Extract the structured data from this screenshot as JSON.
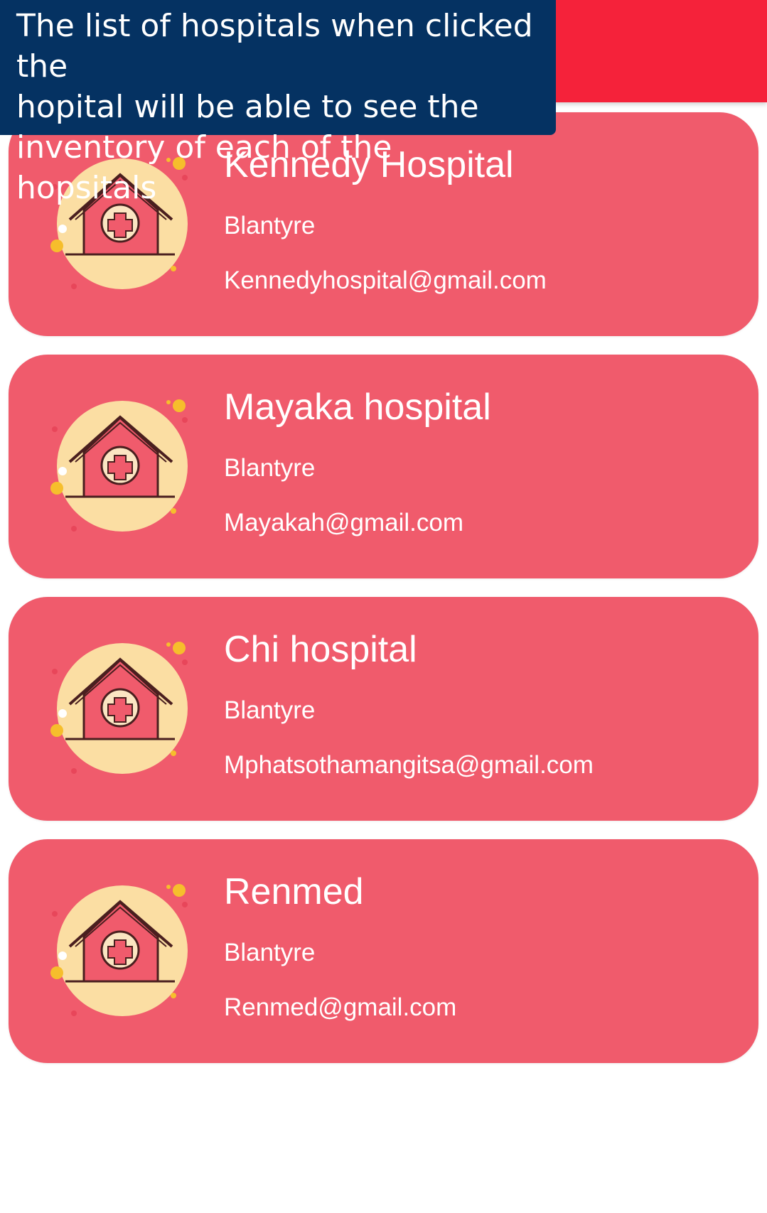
{
  "app_bar": {
    "color": "#f5223a"
  },
  "caption": {
    "lines": [
      "The list of hospitals when clicked the",
      "hopital will be able to see the",
      "inventory of each of the hopsitals"
    ],
    "background": "#053262"
  },
  "hospitals": [
    {
      "name": "Kennedy Hospital",
      "city": "Blantyre",
      "email": "Kennedyhospital@gmail.com",
      "icon": "hospital-icon"
    },
    {
      "name": "Mayaka hospital",
      "city": "Blantyre",
      "email": "Mayakah@gmail.com",
      "icon": "hospital-icon"
    },
    {
      "name": "Chi hospital",
      "city": "Blantyre",
      "email": "Mphatsothamangitsa@gmail.com",
      "icon": "hospital-icon"
    },
    {
      "name": "Renmed",
      "city": "Blantyre",
      "email": "Renmed@gmail.com",
      "icon": "hospital-icon"
    }
  ],
  "colors": {
    "card": "#f05b6c",
    "icon_circle": "#fbdea3",
    "icon_accent": "#f6be2c"
  }
}
